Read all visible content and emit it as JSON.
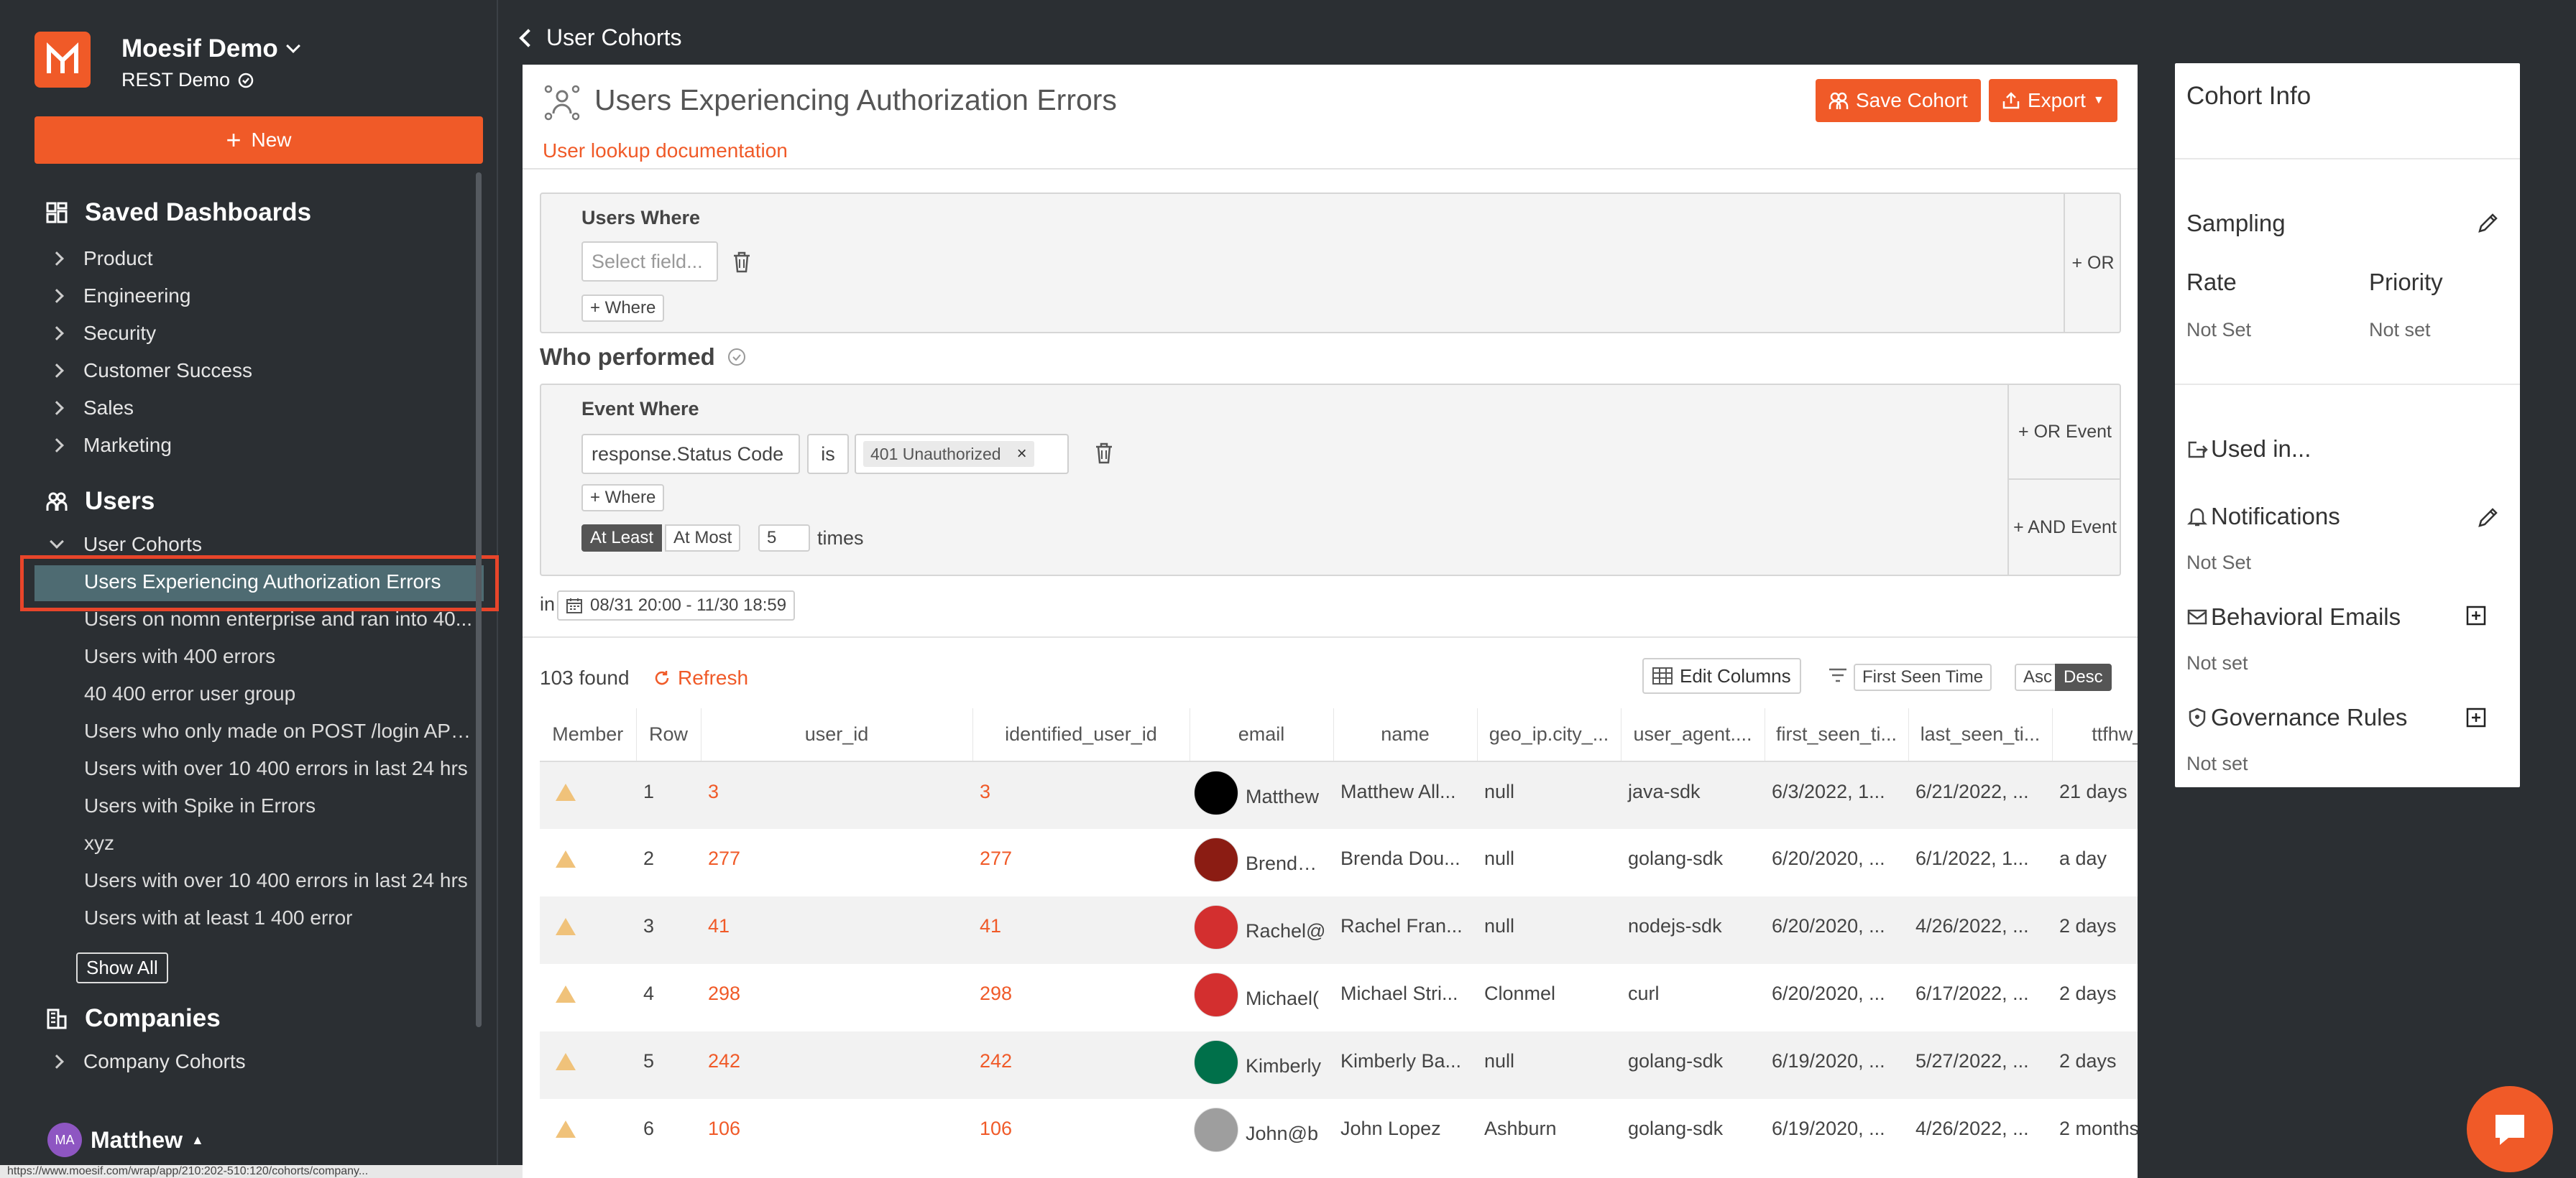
{
  "app": {
    "name": "Moesif Demo",
    "subtitle": "REST Demo",
    "new_label": "New"
  },
  "sidebar": {
    "saved_dashboards_title": "Saved Dashboards",
    "dashboards": [
      "Product",
      "Engineering",
      "Security",
      "Customer Success",
      "Sales",
      "Marketing"
    ],
    "users_title": "Users",
    "user_cohorts_label": "User Cohorts",
    "cohorts": [
      "Users Experiencing Authorization Errors",
      "Users on nomn enterprise and ran into 40...",
      "Users with 400 errors",
      "40 400 error user group",
      "Users who only made on POST /login API ...",
      "Users with over 10 400 errors in last 24 hrs",
      "Users with Spike in Errors",
      "xyz",
      "Users with over 10 400 errors in last 24 hrs",
      "Users with at least 1 400 error"
    ],
    "show_all_label": "Show All",
    "companies_title": "Companies",
    "company_cohorts_label": "Company Cohorts",
    "user_initials": "MA",
    "user_name": "Matthew"
  },
  "status_url": "https://www.moesif.com/wrap/app/210:202-510:120/cohorts/company...",
  "breadcrumb": {
    "back_label": "User Cohorts"
  },
  "cohort": {
    "title": "Users Experiencing Authorization Errors",
    "doc_link": "User lookup documentation",
    "save_label": "Save Cohort",
    "export_label": "Export"
  },
  "users_where": {
    "label": "Users Where",
    "field_placeholder": "Select field...",
    "add_where": "+ Where",
    "or_label": "+ OR"
  },
  "who_performed": {
    "title": "Who performed",
    "event_where_label": "Event Where",
    "field_value": "response.Status Code",
    "operator": "is",
    "chip_value": "401 Unauthorized",
    "add_where": "+ Where",
    "or_event": "+ OR Event",
    "and_event": "+ AND Event",
    "at_least": "At Least",
    "at_most": "At Most",
    "count": "5",
    "times": "times"
  },
  "date_range": {
    "in_label": "in",
    "value": "08/31 20:00 - 11/30 18:59"
  },
  "results": {
    "found_text": "103 found",
    "refresh_label": "Refresh",
    "edit_columns_label": "Edit Columns",
    "sort_field": "First Seen Time",
    "asc_label": "Asc",
    "desc_label": "Desc",
    "columns": [
      "Member",
      "Row",
      "user_id",
      "identified_user_id",
      "email",
      "name",
      "geo_ip.city_...",
      "user_agent....",
      "first_seen_ti...",
      "last_seen_ti...",
      "ttfhw_s"
    ],
    "rows": [
      {
        "row": "1",
        "user_id": "3",
        "identified_user_id": "3",
        "email": "Matthew",
        "name": "Matthew All...",
        "city": "null",
        "agent": "java-sdk",
        "first_seen": "6/3/2022, 1...",
        "last_seen": "6/21/2022, ...",
        "ttfhw": "21 days"
      },
      {
        "row": "2",
        "user_id": "277",
        "identified_user_id": "277",
        "email": "Brenda@",
        "name": "Brenda Dou...",
        "city": "null",
        "agent": "golang-sdk",
        "first_seen": "6/20/2020, ...",
        "last_seen": "6/1/2022, 1...",
        "ttfhw": "a day"
      },
      {
        "row": "3",
        "user_id": "41",
        "identified_user_id": "41",
        "email": "Rachel@",
        "name": "Rachel Fran...",
        "city": "null",
        "agent": "nodejs-sdk",
        "first_seen": "6/20/2020, ...",
        "last_seen": "4/26/2022, ...",
        "ttfhw": "2 days"
      },
      {
        "row": "4",
        "user_id": "298",
        "identified_user_id": "298",
        "email": "Michael(",
        "name": "Michael Stri...",
        "city": "Clonmel",
        "agent": "curl",
        "first_seen": "6/20/2020, ...",
        "last_seen": "6/17/2022, ...",
        "ttfhw": "2 days"
      },
      {
        "row": "5",
        "user_id": "242",
        "identified_user_id": "242",
        "email": "Kimberly",
        "name": "Kimberly Ba...",
        "city": "null",
        "agent": "golang-sdk",
        "first_seen": "6/19/2020, ...",
        "last_seen": "5/27/2022, ...",
        "ttfhw": "2 days"
      },
      {
        "row": "6",
        "user_id": "106",
        "identified_user_id": "106",
        "email": "John@b",
        "name": "John Lopez",
        "city": "Ashburn",
        "agent": "golang-sdk",
        "first_seen": "6/19/2020, ...",
        "last_seen": "4/26/2022, ...",
        "ttfhw": "2 months"
      }
    ]
  },
  "cohort_info": {
    "title": "Cohort Info",
    "sampling": "Sampling",
    "rate_label": "Rate",
    "rate_value": "Not Set",
    "priority_label": "Priority",
    "priority_value": "Not set",
    "used_in": "Used in...",
    "notifications": "Notifications",
    "notifications_value": "Not Set",
    "behavioral_emails": "Behavioral Emails",
    "behavioral_emails_value": "Not set",
    "governance_rules": "Governance Rules",
    "governance_rules_value": "Not set"
  },
  "colors": {
    "accent": "#f05a28",
    "sidebar_bg": "#2b2f33",
    "active_item": "#4e6b72",
    "highlight": "#e8452a"
  }
}
